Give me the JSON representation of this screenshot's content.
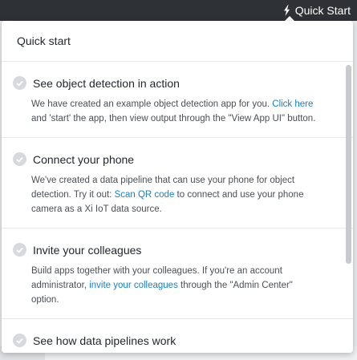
{
  "topbar": {
    "quick_start_label": "Quick Start",
    "icon": "lightning-icon"
  },
  "panel": {
    "title": "Quick start",
    "items": [
      {
        "title": "See object detection in action",
        "desc_before": "We have created an example object detection app for you. ",
        "link": "Click here",
        "desc_after": " and 'start' the app, then view output through the \"View App UI\" button."
      },
      {
        "title": "Connect your phone",
        "desc_before": "We've created a data pipeline that can use your phone for object detection. Try it out: ",
        "link": "Scan QR code",
        "desc_after": " to connect and use your phone camera as a Xi IoT data source."
      },
      {
        "title": "Invite your colleagues",
        "desc_before": "Build apps together with your colleagues. If you're an account administrator, ",
        "link": "invite your colleagues",
        "desc_after": " through the \"Admin Center\" option."
      },
      {
        "title": "See how data pipelines work",
        "desc_before": "",
        "link": "",
        "desc_after": ""
      }
    ]
  },
  "colors": {
    "link": "#1b80c4",
    "topbar": "#2e3136",
    "check": "#d6d9dd"
  }
}
